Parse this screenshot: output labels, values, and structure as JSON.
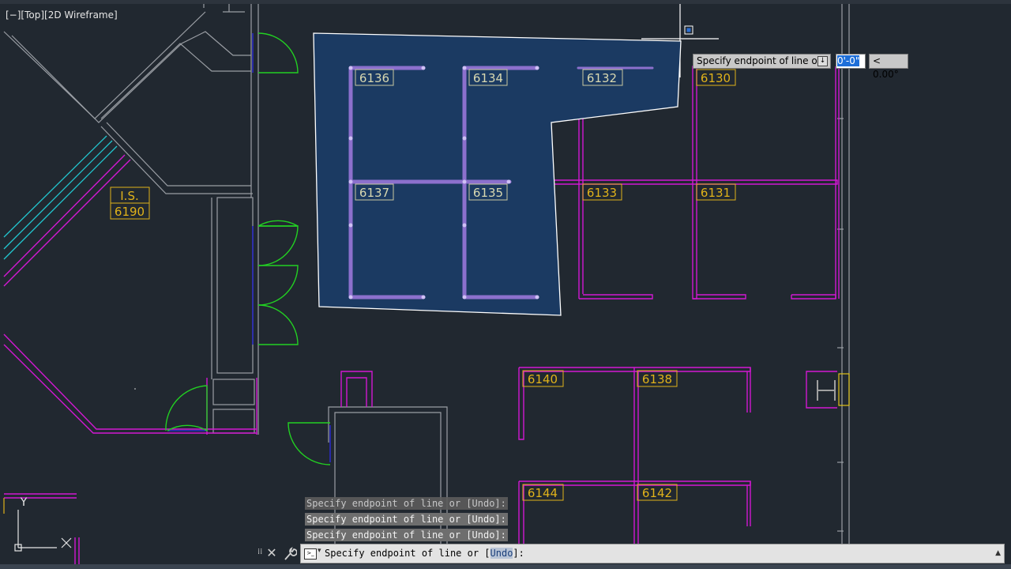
{
  "viewport": {
    "label_minus": "[−]",
    "label_view": "[Top]",
    "label_style": "[2D Wireframe]"
  },
  "rooms": [
    {
      "id": "6136",
      "label": "6136"
    },
    {
      "id": "6134",
      "label": "6134"
    },
    {
      "id": "6132",
      "label": "6132"
    },
    {
      "id": "6130",
      "label": "6130"
    },
    {
      "id": "6137",
      "label": "6137"
    },
    {
      "id": "6135",
      "label": "6135"
    },
    {
      "id": "6133",
      "label": "6133"
    },
    {
      "id": "6131",
      "label": "6131"
    },
    {
      "id": "is",
      "label": "I.S."
    },
    {
      "id": "6190",
      "label": "6190"
    },
    {
      "id": "6140",
      "label": "6140"
    },
    {
      "id": "6138",
      "label": "6138"
    },
    {
      "id": "6144",
      "label": "6144"
    },
    {
      "id": "6142",
      "label": "6142"
    }
  ],
  "ucs": {
    "y_label": "Y"
  },
  "dynamic_input": {
    "prompt": "Specify endpoint of line or",
    "length_value": "0'-0\"",
    "angle_value": "< 0.00°"
  },
  "command_history": [
    "Specify endpoint of line or [Undo]:",
    "Specify endpoint of line or [Undo]:",
    "Specify endpoint of line or [Undo]:"
  ],
  "command_line": {
    "prefix": "Specify endpoint of line or [",
    "option": "Undo",
    "suffix": "]:"
  },
  "colors": {
    "background": "#212830",
    "walls": "#9a9ea4",
    "cubicles": "#d218d2",
    "doors": "#22d022",
    "labels": "#e0b21a",
    "selection_fill": "#1b3a62",
    "cyan_lines": "#22c6cf"
  },
  "icons": {
    "close": "close-icon",
    "customize": "wrench-icon",
    "command_prompt": "terminal-icon"
  }
}
